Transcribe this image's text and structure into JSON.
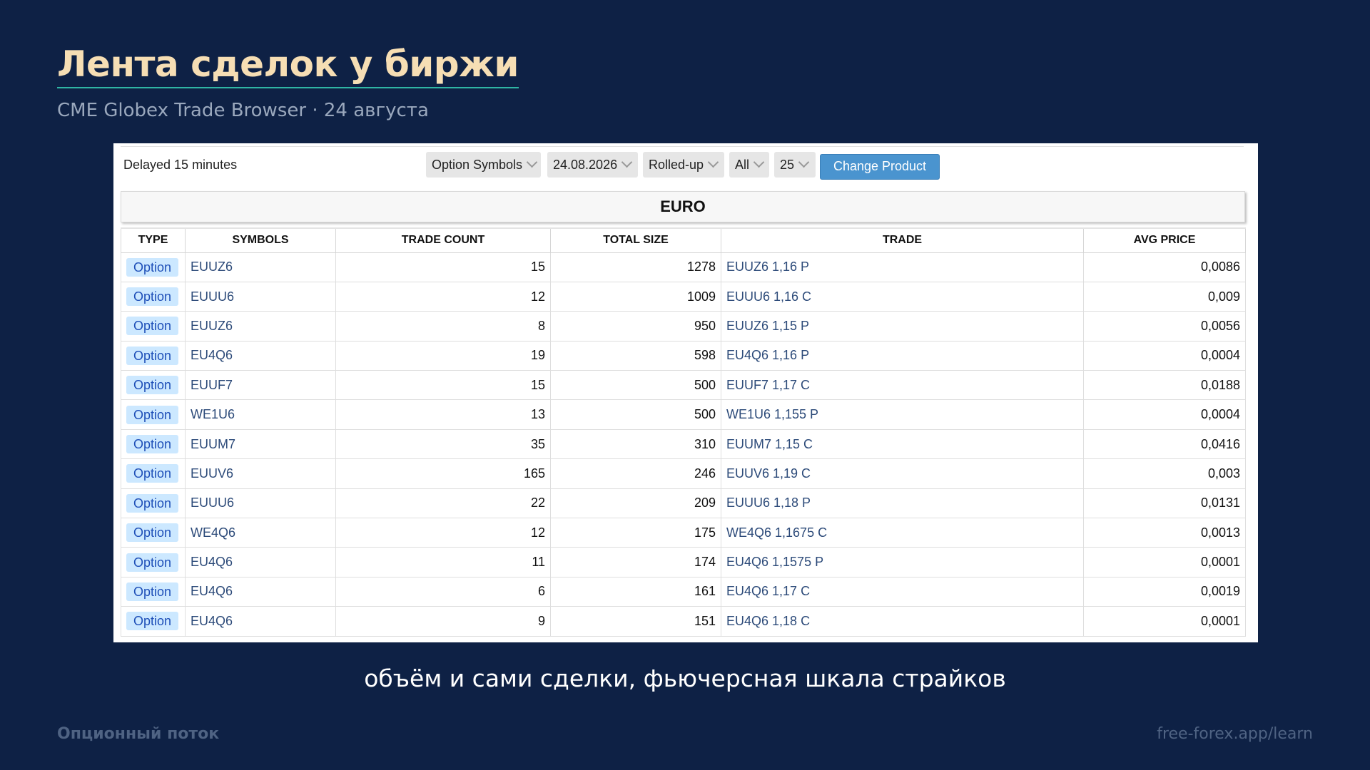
{
  "slide": {
    "title": "Лента сделок у биржи",
    "subtitle": "CME Globex Trade Browser · 24 августа",
    "caption": "объём и сами сделки, фьючерсная шкала страйков",
    "footer_left": "Опционный поток",
    "footer_right": "free-forex.app/learn"
  },
  "browser": {
    "delayed_text": "Delayed 15 minutes",
    "filters": {
      "symbols": "Option Symbols",
      "date": "24.08.2026",
      "view": "Rolled-up",
      "scope": "All",
      "limit": "25"
    },
    "change_button": "Change Product",
    "product_name": "EURO",
    "columns": [
      "TYPE",
      "SYMBOLS",
      "TRADE COUNT",
      "TOTAL SIZE",
      "TRADE",
      "AVG PRICE"
    ],
    "rows": [
      {
        "type": "Option",
        "symbol": "EUUZ6",
        "count": "15",
        "size": "1278",
        "trade": "EUUZ6 1,16 P",
        "avg": "0,0086"
      },
      {
        "type": "Option",
        "symbol": "EUUU6",
        "count": "12",
        "size": "1009",
        "trade": "EUUU6 1,16 C",
        "avg": "0,009"
      },
      {
        "type": "Option",
        "symbol": "EUUZ6",
        "count": "8",
        "size": "950",
        "trade": "EUUZ6 1,15 P",
        "avg": "0,0056"
      },
      {
        "type": "Option",
        "symbol": "EU4Q6",
        "count": "19",
        "size": "598",
        "trade": "EU4Q6 1,16 P",
        "avg": "0,0004"
      },
      {
        "type": "Option",
        "symbol": "EUUF7",
        "count": "15",
        "size": "500",
        "trade": "EUUF7 1,17 C",
        "avg": "0,0188"
      },
      {
        "type": "Option",
        "symbol": "WE1U6",
        "count": "13",
        "size": "500",
        "trade": "WE1U6 1,155 P",
        "avg": "0,0004"
      },
      {
        "type": "Option",
        "symbol": "EUUM7",
        "count": "35",
        "size": "310",
        "trade": "EUUM7 1,15 C",
        "avg": "0,0416"
      },
      {
        "type": "Option",
        "symbol": "EUUV6",
        "count": "165",
        "size": "246",
        "trade": "EUUV6 1,19 C",
        "avg": "0,003"
      },
      {
        "type": "Option",
        "symbol": "EUUU6",
        "count": "22",
        "size": "209",
        "trade": "EUUU6 1,18 P",
        "avg": "0,0131"
      },
      {
        "type": "Option",
        "symbol": "WE4Q6",
        "count": "12",
        "size": "175",
        "trade": "WE4Q6 1,1675 C",
        "avg": "0,0013"
      },
      {
        "type": "Option",
        "symbol": "EU4Q6",
        "count": "11",
        "size": "174",
        "trade": "EU4Q6 1,1575 P",
        "avg": "0,0001"
      },
      {
        "type": "Option",
        "symbol": "EU4Q6",
        "count": "6",
        "size": "161",
        "trade": "EU4Q6 1,17 C",
        "avg": "0,0019"
      },
      {
        "type": "Option",
        "symbol": "EU4Q6",
        "count": "9",
        "size": "151",
        "trade": "EU4Q6 1,18 C",
        "avg": "0,0001"
      }
    ]
  },
  "colors": {
    "background": "#0e2145",
    "title": "#f6deb4",
    "title_underline": "#2fb5a4",
    "button": "#4a94cf",
    "badge_bg": "#cce8ff",
    "badge_text": "#1e4fb8"
  }
}
